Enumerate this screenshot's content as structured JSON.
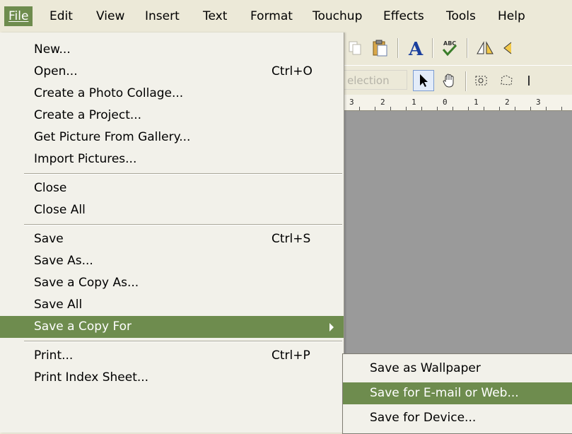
{
  "menubar": {
    "items": [
      "File",
      "Edit",
      "View",
      "Insert",
      "Text",
      "Format",
      "Touchup",
      "Effects",
      "Tools",
      "Help"
    ]
  },
  "toolbar": {
    "selection_label": "election",
    "ruler_ticks": [
      "3",
      "2",
      "1",
      "0",
      "1",
      "2",
      "3"
    ]
  },
  "file_menu": {
    "items": [
      {
        "label": "New...",
        "shortcut": ""
      },
      {
        "label": "Open...",
        "shortcut": "Ctrl+O"
      },
      {
        "label": "Create a Photo Collage...",
        "shortcut": ""
      },
      {
        "label": "Create a Project...",
        "shortcut": ""
      },
      {
        "label": "Get Picture From Gallery...",
        "shortcut": ""
      },
      {
        "label": "Import Pictures...",
        "shortcut": ""
      },
      {
        "label": "Close",
        "shortcut": ""
      },
      {
        "label": "Close All",
        "shortcut": ""
      },
      {
        "label": "Save",
        "shortcut": "Ctrl+S"
      },
      {
        "label": "Save As...",
        "shortcut": ""
      },
      {
        "label": "Save a Copy As...",
        "shortcut": ""
      },
      {
        "label": "Save All",
        "shortcut": ""
      },
      {
        "label": "Save a Copy For",
        "shortcut": ""
      },
      {
        "label": "Print...",
        "shortcut": "Ctrl+P"
      },
      {
        "label": "Print Index Sheet...",
        "shortcut": ""
      }
    ]
  },
  "submenu": {
    "items": [
      {
        "label": "Save as Wallpaper"
      },
      {
        "label": "Save for E-mail or Web..."
      },
      {
        "label": "Save for Device..."
      }
    ]
  },
  "colors": {
    "highlight": "#6e8c4e",
    "menu_bg": "#f2f1ea",
    "canvas": "#9a9a9a"
  }
}
